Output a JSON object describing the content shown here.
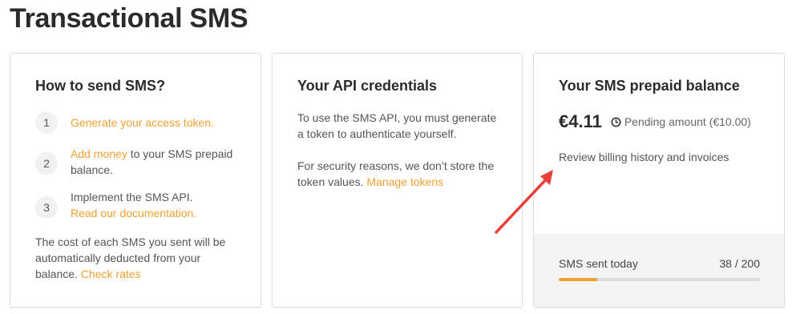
{
  "page": {
    "title": "Transactional SMS"
  },
  "how_to": {
    "title": "How to send SMS?",
    "steps": [
      {
        "number": "1",
        "link": "Generate your access token.",
        "text": ""
      },
      {
        "number": "2",
        "link": "Add money",
        "text": " to your SMS prepaid balance."
      },
      {
        "number": "3",
        "text": "Implement the SMS API.",
        "link": "Read our documentation."
      }
    ],
    "cost_text": "The cost of each SMS you sent will be automatically deducted from your balance. ",
    "cost_link": "Check rates"
  },
  "api": {
    "title": "Your API credentials",
    "para1": "To use the SMS API, you must generate a token to authenticate yourself.",
    "para2": "For security reasons, we don’t store the token values. ",
    "manage_link": "Manage tokens"
  },
  "balance": {
    "title": "Your SMS prepaid balance",
    "amount": "€4.11",
    "pending": "Pending amount (€10.00)",
    "pending_icon": "clock-icon",
    "billing_link": "Review billing history and invoices",
    "sent_label": "SMS sent today",
    "sent_count": "38 / 200",
    "sent_fraction": 0.19
  },
  "colors": {
    "accent": "#f0a133",
    "arrow": "#e8403a"
  }
}
